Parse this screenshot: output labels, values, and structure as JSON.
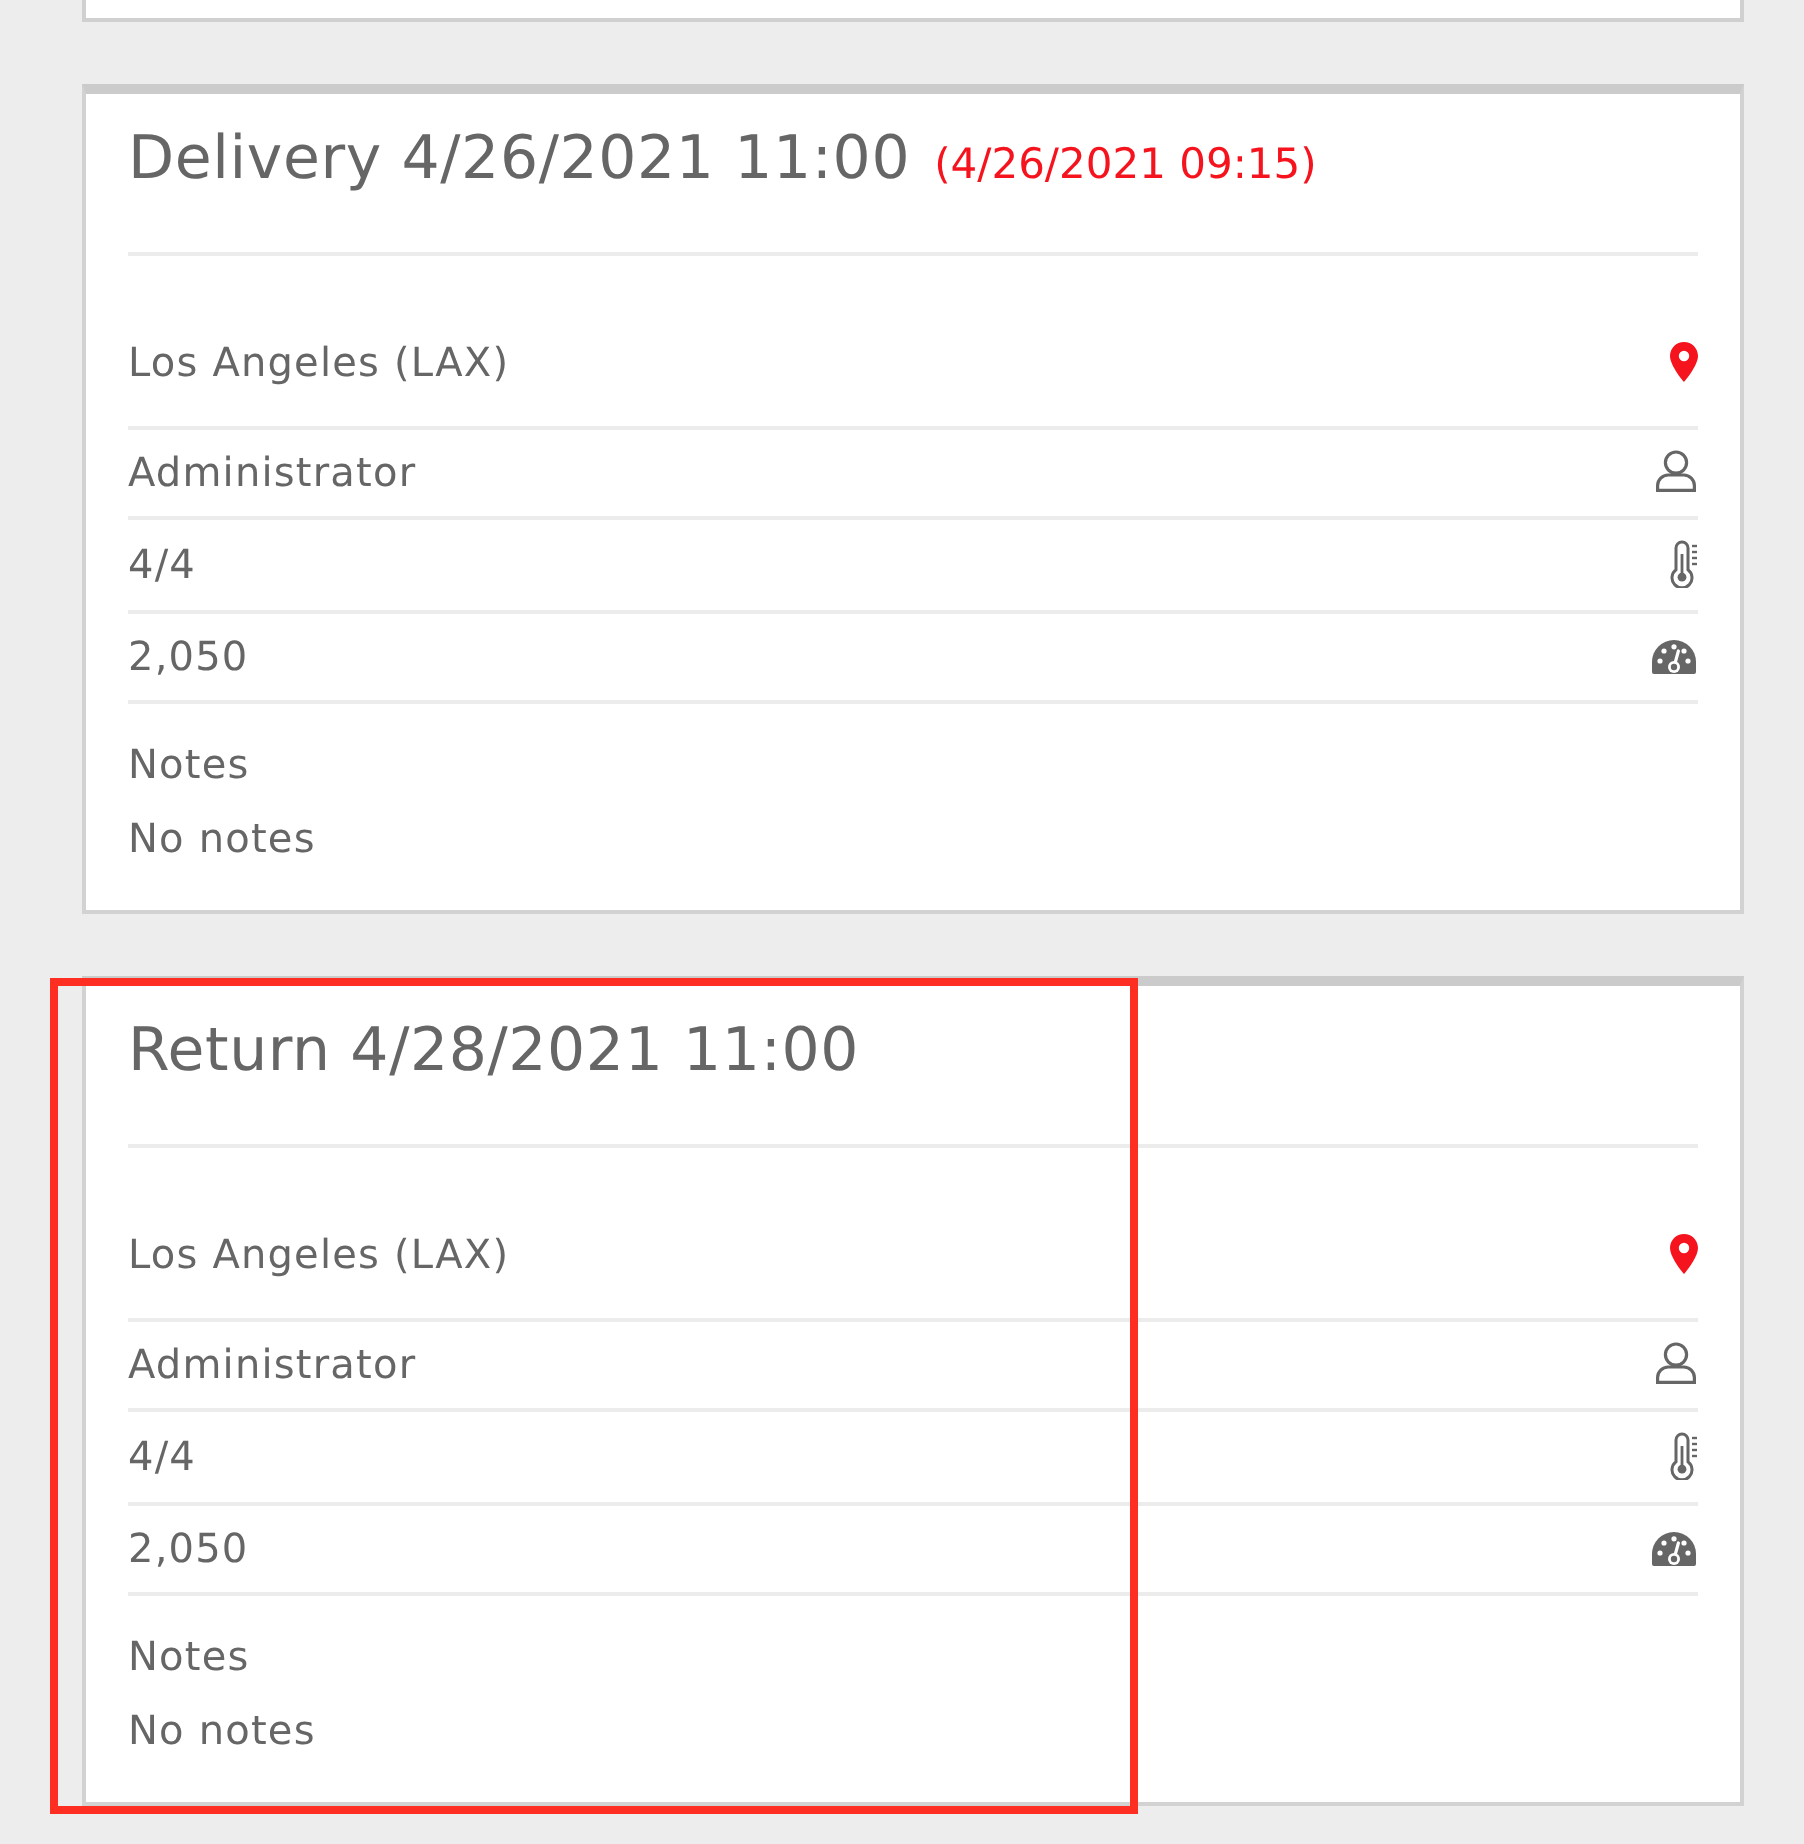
{
  "events": [
    {
      "title": "Delivery 4/26/2021 11:00",
      "actual_time": "(4/26/2021 09:15)",
      "highlighted": false,
      "details": [
        {
          "kind": "location",
          "value": "Los Angeles (LAX)"
        },
        {
          "kind": "user",
          "value": "Administrator"
        },
        {
          "kind": "thermometer",
          "value": "4/4"
        },
        {
          "kind": "gauge",
          "value": "2,050"
        }
      ],
      "notes_label": "Notes",
      "notes": "No notes"
    },
    {
      "title": "Return 4/28/2021 11:00",
      "highlighted": true,
      "details": [
        {
          "kind": "location",
          "value": "Los Angeles (LAX)"
        },
        {
          "kind": "user",
          "value": "Administrator"
        },
        {
          "kind": "thermometer",
          "value": "4/4"
        },
        {
          "kind": "gauge",
          "value": "2,050"
        }
      ],
      "notes_label": "Notes",
      "notes": "No notes"
    }
  ]
}
